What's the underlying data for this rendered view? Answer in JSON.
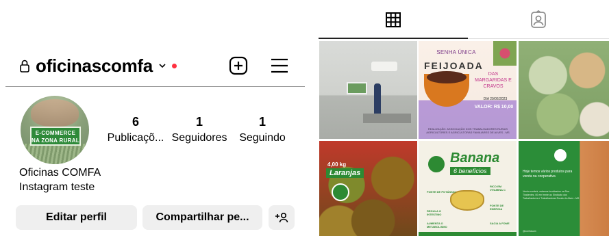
{
  "profile": {
    "username": "oficinascomfa",
    "display_name": "Oficinas COMFA",
    "bio": "Instagram teste",
    "avatar_badge_line1": "E-COMMERCE",
    "avatar_badge_line2": "NA ZONA RURAL",
    "stats": [
      {
        "value": "6",
        "label": "Publicaçõ..."
      },
      {
        "value": "1",
        "label": "Seguidores"
      },
      {
        "value": "1",
        "label": "Seguindo"
      }
    ],
    "buttons": {
      "edit": "Editar perfil",
      "share": "Compartilhar pe..."
    }
  },
  "icons": {
    "lock": "lock-icon",
    "chevron": "chevron-down-icon",
    "add": "add-post-icon",
    "menu": "hamburger-menu-icon",
    "grid": "grid-icon",
    "tagged": "tagged-person-icon",
    "add_person": "add-person-icon"
  },
  "colors": {
    "notification_dot": "#ff3040",
    "button_bg": "#efefef",
    "brand_green": "#2d8a33"
  },
  "posts": {
    "feijoada": {
      "top": "SENHA ÚNICA",
      "title": "FEIJOADA",
      "subtitle": "DAS MARGARIDAS E CRAVOS",
      "date": "DIA 29/06/2023",
      "price": "VALOR: R$ 10,00",
      "footer": "REALIZAÇÃO: ASSOCIAÇÃO DOS TRABALHADORES RURAIS AGRICULTORES E AGRICULTORAS FAMILIARES DE ALVES - MS"
    },
    "laranjas": {
      "weight": "4,00 kg",
      "title": "Laranjas"
    },
    "banana": {
      "title": "Banana",
      "subtitle": "6 benefícios",
      "labels": [
        "FONTE DE POTÁSSIO",
        "RICO EM VITAMINA C",
        "FONTE DE ENERGIA",
        "REGULA O INTESTINO",
        "AUMENTA O METABOLISMO",
        "SACIA A FOME"
      ]
    },
    "green": {
      "headline": "Hoje temos vários produtos para venda na cooperativa",
      "body": "Venha conferir, estamos localizados na Rua Tiradentes, 00 em frente ao Sindicato dos Trabalhadores e Trabalhadoras Rurais de Alves - MS",
      "handle": "@comfasum"
    }
  }
}
